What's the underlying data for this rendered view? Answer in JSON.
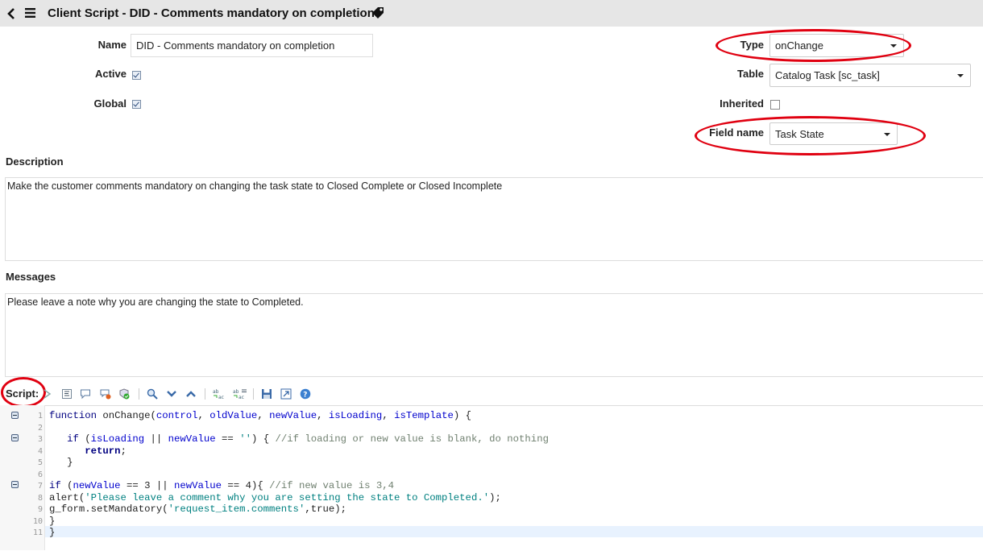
{
  "header": {
    "title": "Client Script - DID - Comments mandatory on completion",
    "back_icon": "chevron-left-icon",
    "menu_icon": "hamburger-menu-icon",
    "tag_icon": "tag-icon"
  },
  "form": {
    "name_label": "Name",
    "name_value": "DID - Comments mandatory on completion",
    "active_label": "Active",
    "active_checked": true,
    "global_label": "Global",
    "global_checked": true,
    "type_label": "Type",
    "type_value": "onChange",
    "table_label": "Table",
    "table_value": "Catalog Task [sc_task]",
    "inherited_label": "Inherited",
    "inherited_checked": false,
    "field_name_label": "Field name",
    "field_name_value": "Task State",
    "description_label": "Description",
    "description_value": "Make the customer comments mandatory on changing the task state to Closed Complete or Closed Incomplete",
    "messages_label": "Messages",
    "messages_value": "Please leave a note why you are changing the state to Completed.",
    "script_label": "Script:"
  },
  "toolbar_icons": [
    "toggle-comment-icon",
    "format-code-icon",
    "comment-icon",
    "remove-comment-icon",
    "check-syntax-icon",
    "search-icon",
    "find-next-icon",
    "find-previous-icon",
    "replace-icon",
    "replace-all-icon",
    "save-icon",
    "fullscreen-icon",
    "help-icon"
  ],
  "script": {
    "line_numbers": [
      "1",
      "2",
      "3",
      "4",
      "5",
      "6",
      "7",
      "8",
      "9",
      "10",
      "11"
    ],
    "lines": [
      "function onChange(control, oldValue, newValue, isLoading, isTemplate) {",
      "",
      "   if (isLoading || newValue == '') { //if loading or new value is blank, do nothing",
      "      return;",
      "   }",
      "",
      "if (newValue == 3 || newValue == 4){ //if new value is 3,4",
      "alert('Please leave a comment why you are setting the state to Completed.');",
      "g_form.setMandatory('request_item.comments',true);",
      "}",
      "}"
    ]
  },
  "colors": {
    "header_bg": "#e6e6e6",
    "highlight_ring": "#e00010",
    "keyword": "#000080",
    "variable": "#0000cd",
    "comment": "#708070",
    "string": "#008080"
  }
}
